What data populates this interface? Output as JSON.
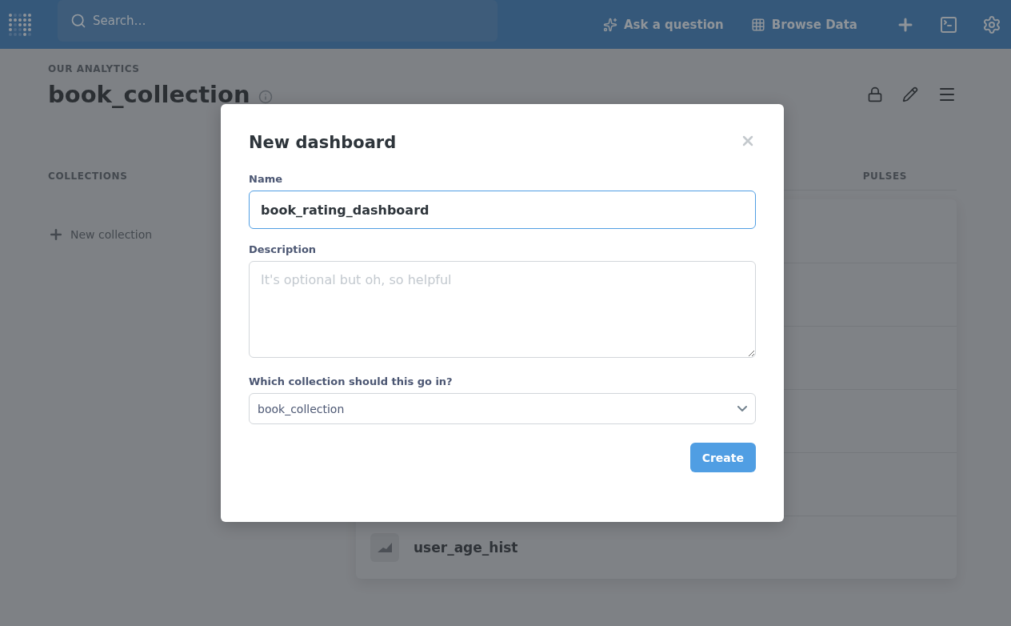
{
  "topbar": {
    "search": {
      "placeholder": "Search…"
    },
    "actions": [
      {
        "kind": "ask",
        "label": "Ask a question"
      },
      {
        "kind": "browse",
        "label": "Browse Data"
      }
    ]
  },
  "page": {
    "breadcrumb": "OUR ANALYTICS",
    "title": "book_collection",
    "collections_heading": "COLLECTIONS",
    "new_collection": "New collection",
    "tab": "PULSES",
    "rows": [
      {
        "name": ""
      },
      {
        "name": ""
      },
      {
        "name": ""
      },
      {
        "name": ""
      },
      {
        "name": ""
      },
      {
        "name": "user_age_hist"
      }
    ]
  },
  "modal": {
    "title": "New dashboard",
    "name": {
      "label": "Name",
      "value": "book_rating_dashboard"
    },
    "description": {
      "label": "Description",
      "placeholder": "It's optional but oh, so helpful"
    },
    "collection": {
      "label": "Which collection should this go in?",
      "value": "book_collection"
    },
    "button": "Create"
  }
}
